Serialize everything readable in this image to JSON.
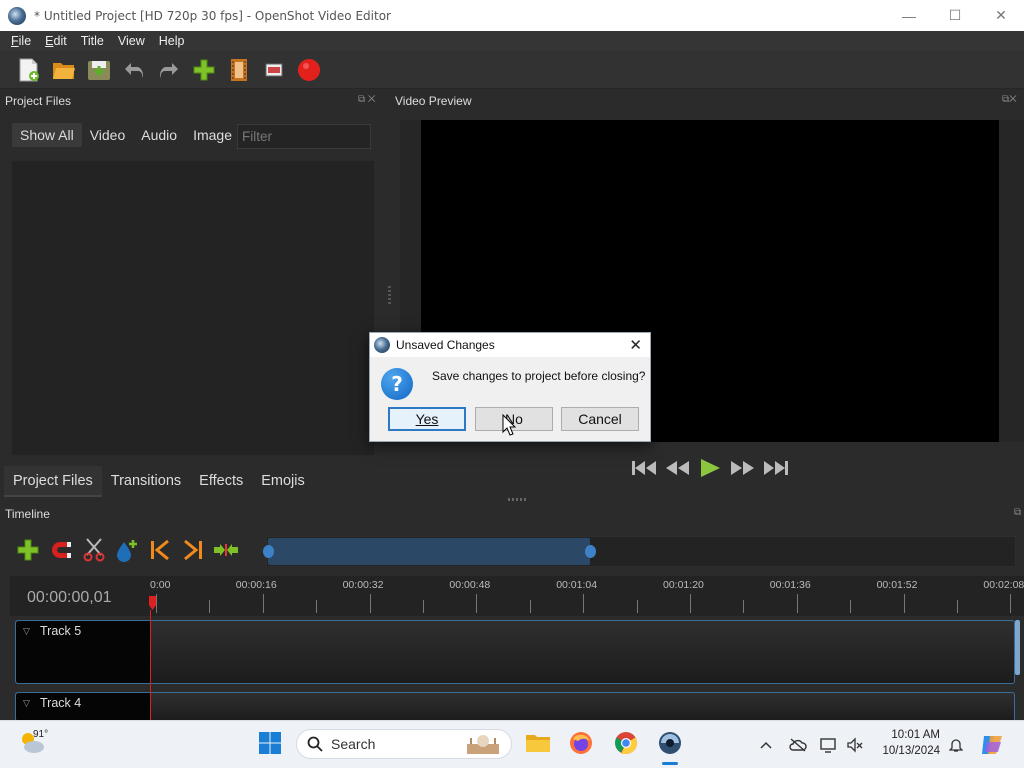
{
  "window": {
    "title": "* Untitled Project [HD 720p 30 fps] - OpenShot Video Editor",
    "minimize": "—",
    "maximize": "☐",
    "close": "✕"
  },
  "menu": [
    {
      "label": "File",
      "underline": "F",
      "rest": "ile"
    },
    {
      "label": "Edit",
      "underline": "E",
      "rest": "dit"
    },
    {
      "label": "Title",
      "underline": "",
      "rest": "Title"
    },
    {
      "label": "View",
      "underline": "",
      "rest": "View"
    },
    {
      "label": "Help",
      "underline": "",
      "rest": "Help"
    }
  ],
  "toolbar": {
    "icons": [
      "new-project-icon",
      "open-project-icon",
      "save-project-icon",
      "undo-icon",
      "redo-icon",
      "import-files-icon",
      "choose-profile-icon",
      "fullscreen-icon",
      "export-video-icon"
    ]
  },
  "project_files": {
    "title": "Project Files",
    "tabs": [
      "Show All",
      "Video",
      "Audio",
      "Image"
    ],
    "filter_placeholder": "Filter"
  },
  "video_preview": {
    "title": "Video Preview"
  },
  "panel_tabs": [
    "Project Files",
    "Transitions",
    "Effects",
    "Emojis"
  ],
  "timeline": {
    "title": "Timeline",
    "current_time": "00:00:00,01",
    "ticks": [
      "0:00",
      "00:00:16",
      "00:00:32",
      "00:00:48",
      "00:01:04",
      "00:01:20",
      "00:01:36",
      "00:01:52",
      "00:02:08"
    ],
    "tracks": [
      "Track 5",
      "Track 4"
    ]
  },
  "dialog": {
    "title": "Unsaved Changes",
    "message": "Save changes to project before closing?",
    "yes_label": "Yes",
    "no_label": "No",
    "cancel_label": "Cancel"
  },
  "taskbar": {
    "temperature": "91°",
    "search_label": "Search",
    "time": "10:01 AM",
    "date": "10/13/2024"
  }
}
